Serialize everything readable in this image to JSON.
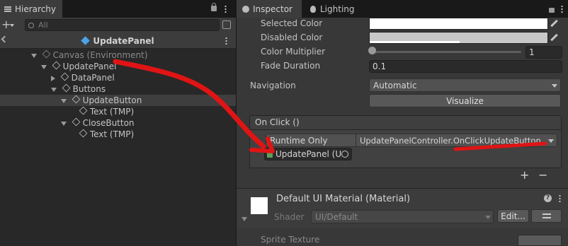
{
  "hierarchy": {
    "tab_label": "Hierarchy",
    "search_placeholder": "All",
    "scene_title": "UpdatePanel",
    "tree": [
      {
        "label": "Canvas (Environment)",
        "dim": true
      },
      {
        "label": "UpdatePanel"
      },
      {
        "label": "DataPanel"
      },
      {
        "label": "Buttons"
      },
      {
        "label": "UpdateButton"
      },
      {
        "label": "Text (TMP)"
      },
      {
        "label": "CloseButton"
      },
      {
        "label": "Text (TMP)"
      }
    ]
  },
  "inspector": {
    "tabs": [
      {
        "label": "Inspector"
      },
      {
        "label": "Lighting"
      }
    ],
    "fields": {
      "selected_color": "Selected Color",
      "disabled_color": "Disabled Color",
      "color_multiplier": "Color Multiplier",
      "color_multiplier_value": "1",
      "fade_duration": "Fade Duration",
      "fade_duration_value": "0.1",
      "navigation": "Navigation",
      "navigation_value": "Automatic",
      "visualize": "Visualize"
    },
    "onclick": {
      "header": "On Click ()",
      "runtime": "Runtime Only",
      "function": "UpdatePanelController.OnClickUpdateButton",
      "target": "UpdatePanel (U",
      "add": "+",
      "remove": "−"
    },
    "material": {
      "name": "Default UI Material (Material)",
      "shader_label": "Shader",
      "shader_value": "UI/Default",
      "edit": "Edit...",
      "help": "?"
    },
    "sprite_texture": "Sprite Texture"
  },
  "colors": {
    "annotation_red": "#e01414",
    "accent_blue": "#4aa3e8"
  },
  "icons": [
    "hamburger-icon",
    "lock-icon",
    "kebab-menu-icon",
    "plus-icon",
    "search-icon",
    "cube-icon",
    "lightbulb-icon",
    "eyedropper-icon",
    "help-icon",
    "settings-icon"
  ]
}
